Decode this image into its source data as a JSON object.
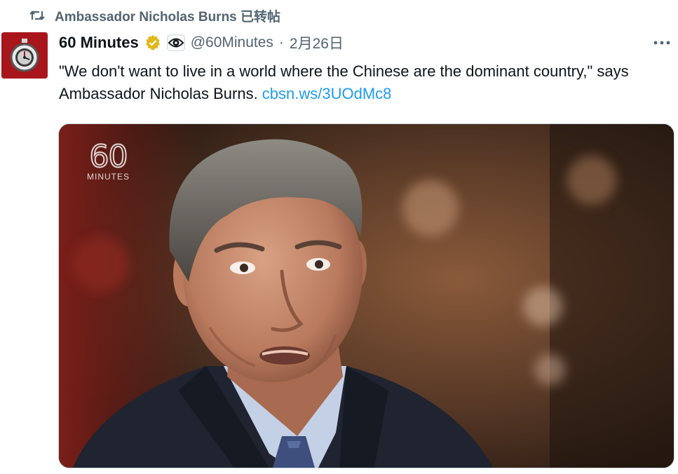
{
  "repost": {
    "icon": "repost-icon",
    "text": "Ambassador Nicholas Burns 已转帖"
  },
  "tweet": {
    "avatar_icon": "stopwatch-avatar-icon",
    "display_name": "60 Minutes",
    "verified_icon": "verified-badge-icon",
    "affiliation_icon": "cbs-eye-icon",
    "handle": "@60Minutes",
    "separator": "·",
    "date": "2月26日",
    "more_icon": "more-options-icon",
    "text": "\"We don't want to live in a world where the Chinese are the dominant country,\" says Ambassador Nicholas Burns. ",
    "link": "cbsn.ws/3UOdMc8",
    "media": {
      "logo_number": "60",
      "logo_word": "MINUTES"
    }
  },
  "colors": {
    "text": "#0f1419",
    "secondary": "#536471",
    "link": "#1d9bf0",
    "verified": "#e2b719",
    "avatar_bg": "#a8161b"
  }
}
